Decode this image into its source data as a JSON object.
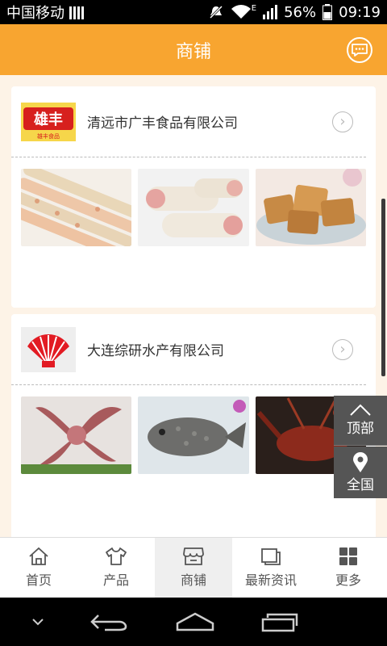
{
  "status_bar": {
    "carrier": "中国移动",
    "battery": "56%",
    "time": "09:19",
    "network": "E"
  },
  "header": {
    "title": "商铺"
  },
  "stores": [
    {
      "name": "清远市广丰食品有限公司",
      "logo_text": "雄丰",
      "logo_subtext": "雄丰食品",
      "brand_color": "#d7201d"
    },
    {
      "name": "大连综研水产有限公司",
      "logo_color": "#e21b23"
    }
  ],
  "float_buttons": {
    "top_label": "顶部",
    "all_label": "全国"
  },
  "tabs": [
    {
      "label": "首页",
      "icon": "home-icon"
    },
    {
      "label": "产品",
      "icon": "shirt-icon"
    },
    {
      "label": "商铺",
      "icon": "store-icon",
      "active": true
    },
    {
      "label": "最新资讯",
      "icon": "news-icon"
    },
    {
      "label": "更多",
      "icon": "grid-icon"
    }
  ],
  "colors": {
    "accent": "#f8a530",
    "background": "#fdf3e7"
  }
}
